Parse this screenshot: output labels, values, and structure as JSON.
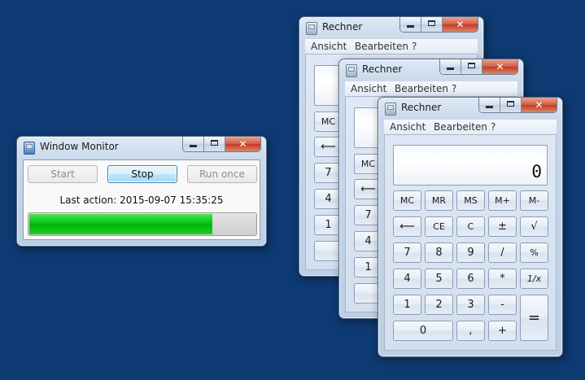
{
  "window_monitor": {
    "title": "Window Monitor",
    "buttons": {
      "start": "Start",
      "stop": "Stop",
      "run_once": "Run once"
    },
    "status": "Last action: 2015-09-07 15:35:25",
    "progress_fraction": 0.81,
    "caption": {
      "minimize": "minimize",
      "maximize": "maximize",
      "close": "✕"
    }
  },
  "calculators": [
    {
      "title": "Rechner",
      "menu": [
        "Ansicht",
        "Bearbeiten",
        "?"
      ],
      "visible_keys": [
        "MC",
        "⟵",
        "7",
        "4",
        "1"
      ]
    },
    {
      "title": "Rechner",
      "menu": [
        "Ansicht",
        "Bearbeiten",
        "?"
      ],
      "visible_keys": [
        "MC",
        "⟵",
        "7",
        "4",
        "1"
      ]
    },
    {
      "title": "Rechner",
      "menu": [
        "Ansicht",
        "Bearbeiten",
        "?"
      ],
      "display": "0",
      "keys": {
        "mc": "MC",
        "mr": "MR",
        "ms": "MS",
        "mplus": "M+",
        "mminus": "M-",
        "back": "⟵",
        "ce": "CE",
        "c": "C",
        "plusminus": "±",
        "sqrt": "√",
        "d7": "7",
        "d8": "8",
        "d9": "9",
        "div": "/",
        "pct": "%",
        "d4": "4",
        "d5": "5",
        "d6": "6",
        "mul": "*",
        "recip": "1/x",
        "d1": "1",
        "d2": "2",
        "d3": "3",
        "minus": "-",
        "eq": "=",
        "d0": "0",
        "comma": ",",
        "plus": "+"
      }
    }
  ],
  "colors": {
    "desktop": "#0e3a73",
    "progress_fill": "#06c30f",
    "close_button": "#c23a1f"
  }
}
